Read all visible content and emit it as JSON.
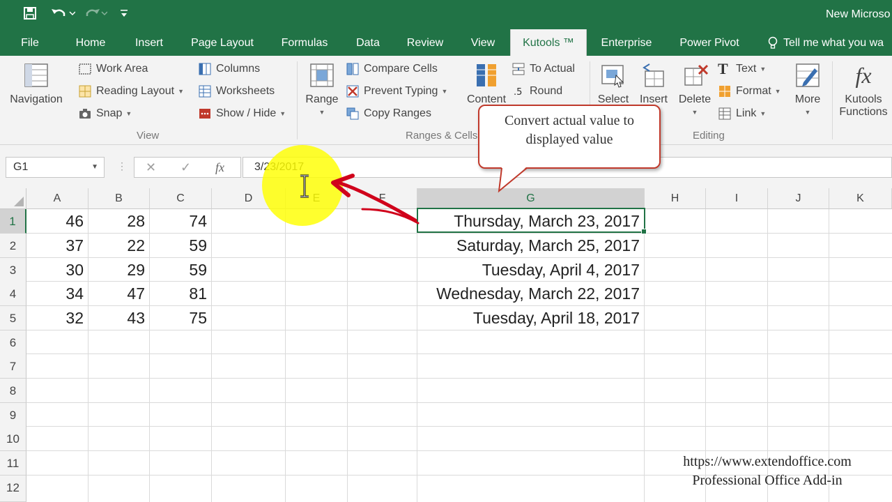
{
  "titlebar": {
    "doc_title": "New Microso"
  },
  "tabs": [
    "File",
    "Home",
    "Insert",
    "Page Layout",
    "Formulas",
    "Data",
    "Review",
    "View",
    "Kutools ™",
    "Enterprise",
    "Power Pivot",
    "Tell me what you wa"
  ],
  "ribbon": {
    "navigation": "Navigation",
    "work_area": "Work Area",
    "reading_layout": "Reading Layout",
    "snap": "Snap",
    "columns": "Columns",
    "worksheets": "Worksheets",
    "show_hide": "Show / Hide",
    "view_group": "View",
    "range": "Range",
    "compare_cells": "Compare Cells",
    "prevent_typing": "Prevent Typing",
    "copy_ranges": "Copy Ranges",
    "ranges_group": "Ranges & Cells",
    "content": "Content",
    "to_actual": "To Actual",
    "round": "Round",
    "select": "Select",
    "insert": "Insert",
    "delete": "Delete",
    "text": "Text",
    "format": "Format",
    "link": "Link",
    "editing_group": "Editing",
    "more": "More",
    "kutools_functions_1": "Kutools",
    "kutools_functions_2": "Functions"
  },
  "formula_bar": {
    "name_box": "G1",
    "value": "3/23/2017"
  },
  "columns": [
    "A",
    "B",
    "C",
    "D",
    "E",
    "F",
    "G",
    "H",
    "I",
    "J",
    "K"
  ],
  "rows": [
    "1",
    "2",
    "3",
    "4",
    "5",
    "6",
    "7",
    "8",
    "9",
    "10",
    "11",
    "12"
  ],
  "cells": {
    "A": [
      "46",
      "37",
      "30",
      "34",
      "32"
    ],
    "B": [
      "28",
      "22",
      "29",
      "47",
      "43"
    ],
    "C": [
      "74",
      "59",
      "59",
      "81",
      "75"
    ],
    "G": [
      "Thursday, March 23, 2017",
      "Saturday, March 25, 2017",
      "Tuesday, April 4, 2017",
      "Wednesday, March 22, 2017",
      "Tuesday, April 18, 2017"
    ]
  },
  "callout": {
    "line1": "Convert actual value to",
    "line2": "displayed value"
  },
  "watermark": {
    "url": "https://www.extendoffice.com",
    "tagline": "Professional Office Add-in"
  },
  "colors": {
    "excel_green": "#217346",
    "callout_border": "#c0392b",
    "highlight": "#ffff00",
    "arrow": "#d0021b"
  }
}
